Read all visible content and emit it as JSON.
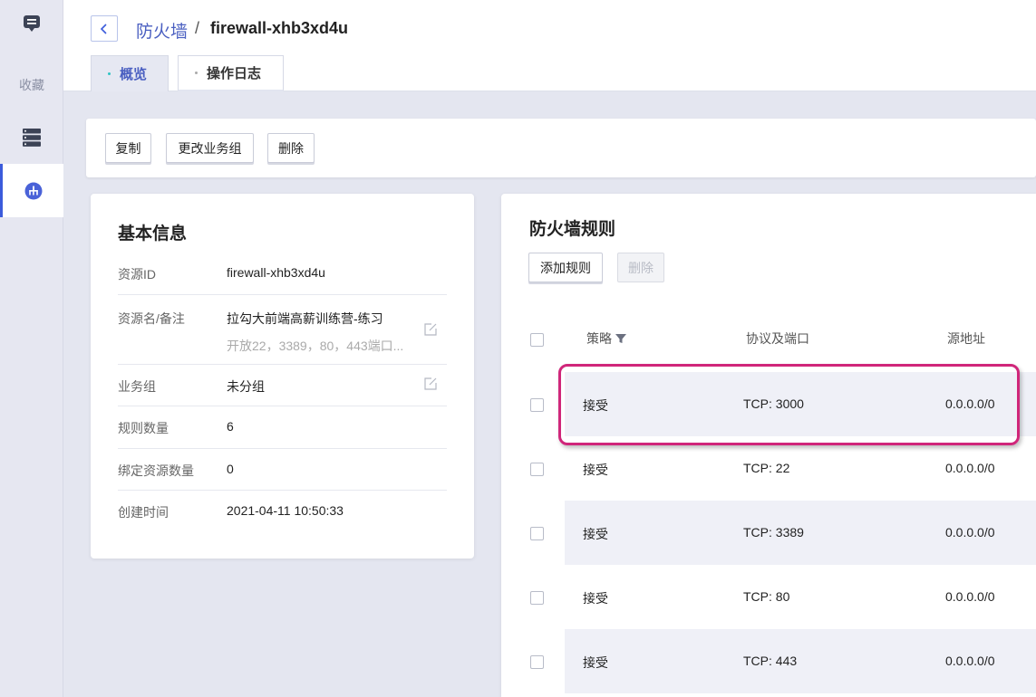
{
  "sidebar": {
    "items": [
      {
        "icon": "chat-icon"
      },
      {
        "label": "收藏"
      },
      {
        "icon": "server-list-icon"
      },
      {
        "icon": "network-icon",
        "active": true
      }
    ]
  },
  "header": {
    "breadcrumb_link": "防火墙",
    "separator": "/",
    "title": "firewall-xhb3xd4u",
    "tabs": [
      {
        "label": "概览",
        "active": true
      },
      {
        "label": "操作日志",
        "active": false
      }
    ]
  },
  "toolbar": {
    "copy_label": "复制",
    "change_group_label": "更改业务组",
    "delete_label": "删除"
  },
  "basic_info": {
    "title": "基本信息",
    "rows": [
      {
        "label": "资源ID",
        "value": "firewall-xhb3xd4u"
      },
      {
        "label": "资源名/备注",
        "value": "拉勾大前端高薪训练营-练习",
        "note": "开放22，3389，80，443端口..."
      },
      {
        "label": "业务组",
        "value": "未分组"
      },
      {
        "label": "规则数量",
        "value": "6"
      },
      {
        "label": "绑定资源数量",
        "value": "0"
      },
      {
        "label": "创建时间",
        "value": "2021-04-11 10:50:33"
      }
    ]
  },
  "rules": {
    "title": "防火墙规则",
    "add_label": "添加规则",
    "delete_label": "删除",
    "columns": {
      "policy": "策略",
      "protocol_port": "协议及端口",
      "source": "源地址"
    },
    "rows": [
      {
        "policy": "接受",
        "protocol_port": "TCP: 3000",
        "source": "0.0.0.0/0"
      },
      {
        "policy": "接受",
        "protocol_port": "TCP: 22",
        "source": "0.0.0.0/0"
      },
      {
        "policy": "接受",
        "protocol_port": "TCP: 3389",
        "source": "0.0.0.0/0"
      },
      {
        "policy": "接受",
        "protocol_port": "TCP: 80",
        "source": "0.0.0.0/0"
      },
      {
        "policy": "接受",
        "protocol_port": "TCP: 443",
        "source": "0.0.0.0/0"
      }
    ]
  },
  "colors": {
    "accent": "#4a5fc1",
    "highlight": "#d0267a",
    "tab_dot": "#2ec4c4"
  }
}
